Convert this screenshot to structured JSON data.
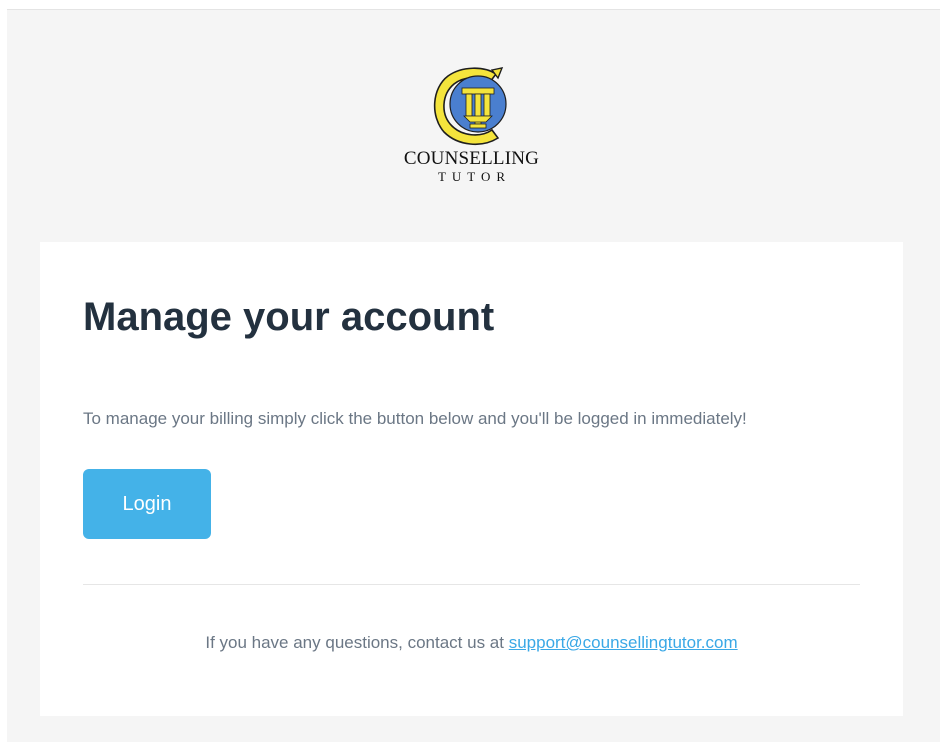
{
  "brand": {
    "name_line_1": "COUNSELLING",
    "name_line_2": "TUTOR"
  },
  "card": {
    "title": "Manage your account",
    "body": "To manage your billing simply click the button below and you'll be logged in immediately!",
    "button_label": "Login",
    "footer_prefix": "If you have any questions, contact us at ",
    "support_email": "support@counsellingtutor.com"
  },
  "colors": {
    "background": "#f5f5f5",
    "card": "#ffffff",
    "title": "#23313f",
    "body_text": "#6b7785",
    "button": "#44b2e8",
    "link": "#3aa8e6",
    "logo_yellow": "#f4e43c",
    "logo_blue": "#4a7fcf"
  },
  "icons": {
    "logo": "counselling-tutor-logo-icon"
  }
}
